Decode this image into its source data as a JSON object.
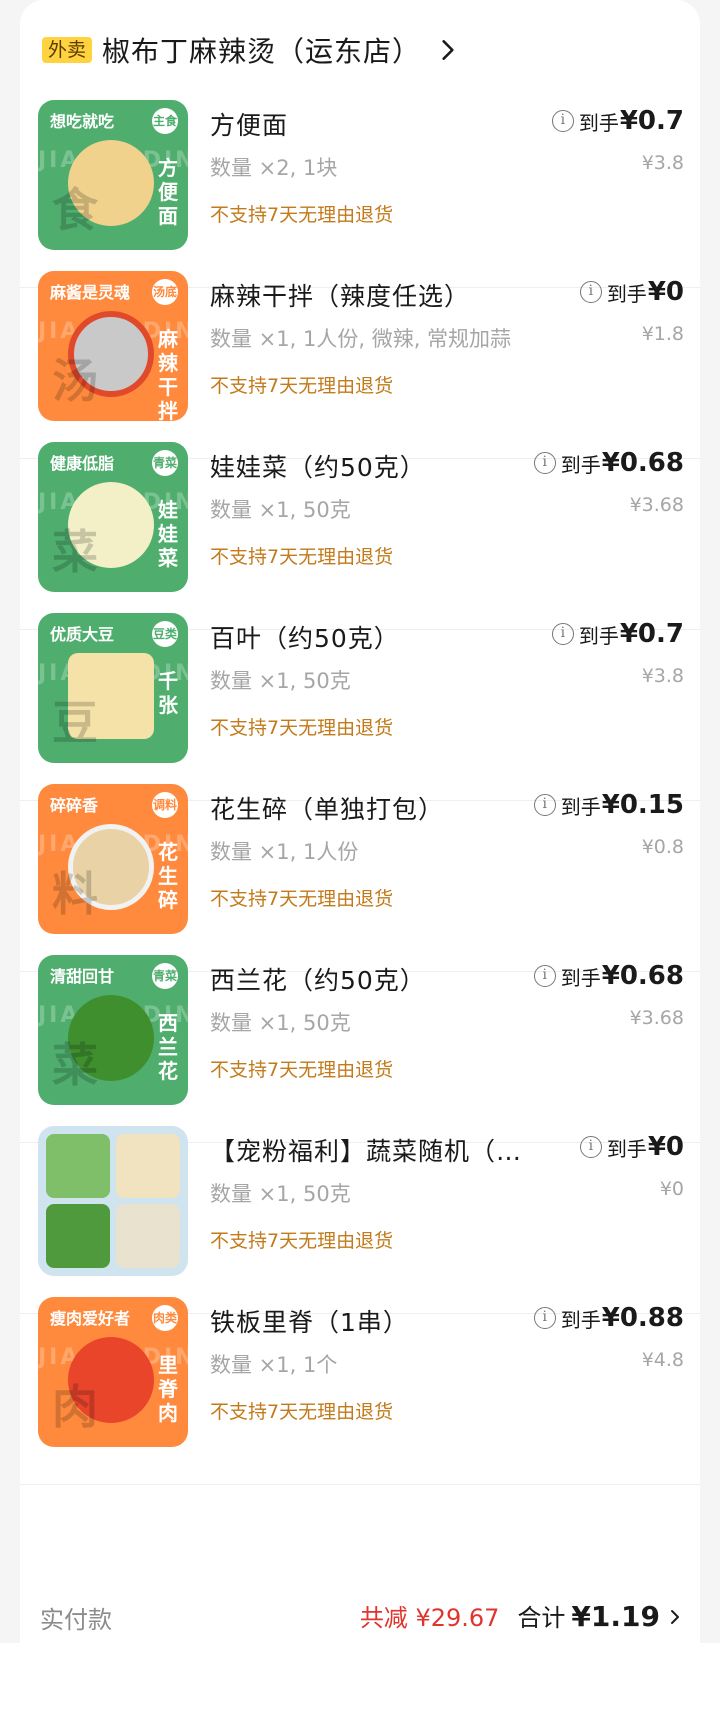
{
  "shop": {
    "tag": "外卖",
    "name": "椒布丁麻辣烫（运东店）"
  },
  "items": [
    {
      "name": "方便面",
      "spec": "数量 ×2, 1块",
      "policy": "不支持7天无理由退货",
      "price_label": "到手",
      "price": "¥0.7",
      "original_price": "¥3.8",
      "thumb": {
        "color": "#4fae6e",
        "label": "想吃就吃",
        "badge": "主食",
        "vertical": "方便面",
        "big": "食"
      }
    },
    {
      "name": "麻辣干拌（辣度任选）",
      "spec": "数量 ×1, 1人份, 微辣, 常规加蒜",
      "policy": "不支持7天无理由退货",
      "price_label": "到手",
      "price": "¥0",
      "original_price": "¥1.8",
      "thumb": {
        "color": "#ff8a3d",
        "label": "麻酱是灵魂",
        "badge": "汤底",
        "vertical": "麻辣干拌",
        "big": "汤"
      }
    },
    {
      "name": "娃娃菜（约50克）",
      "spec": "数量 ×1, 50克",
      "policy": "不支持7天无理由退货",
      "price_label": "到手",
      "price": "¥0.68",
      "original_price": "¥3.68",
      "thumb": {
        "color": "#4fae6e",
        "label": "健康低脂",
        "badge": "青菜",
        "vertical": "娃娃菜",
        "big": "菜"
      }
    },
    {
      "name": "百叶（约50克）",
      "spec": "数量 ×1, 50克",
      "policy": "不支持7天无理由退货",
      "price_label": "到手",
      "price": "¥0.7",
      "original_price": "¥3.8",
      "thumb": {
        "color": "#4fae6e",
        "label": "优质大豆",
        "badge": "豆类",
        "vertical": "千张",
        "big": "豆"
      }
    },
    {
      "name": "花生碎（单独打包）",
      "spec": "数量 ×1, 1人份",
      "policy": "不支持7天无理由退货",
      "price_label": "到手",
      "price": "¥0.15",
      "original_price": "¥0.8",
      "thumb": {
        "color": "#ff8a3d",
        "label": "碎碎香",
        "badge": "调料",
        "vertical": "花生碎",
        "big": "料"
      }
    },
    {
      "name": "西兰花（约50克）",
      "spec": "数量 ×1, 50克",
      "policy": "不支持7天无理由退货",
      "price_label": "到手",
      "price": "¥0.68",
      "original_price": "¥3.68",
      "thumb": {
        "color": "#4fae6e",
        "label": "清甜回甘",
        "badge": "青菜",
        "vertical": "西兰花",
        "big": "菜"
      }
    },
    {
      "name": "【宠粉福利】蔬菜随机（每…",
      "spec": "数量 ×1, 50克",
      "policy": "不支持7天无理由退货",
      "price_label": "到手",
      "price": "¥0",
      "original_price": "¥0",
      "thumb": {
        "color": "#cfe4ef",
        "label": "",
        "badge": "",
        "vertical": "",
        "big": ""
      }
    },
    {
      "name": "铁板里脊（1串）",
      "spec": "数量 ×1, 1个",
      "policy": "不支持7天无理由退货",
      "price_label": "到手",
      "price": "¥0.88",
      "original_price": "¥4.8",
      "thumb": {
        "color": "#ff8a3d",
        "label": "瘦肉爱好者",
        "badge": "肉类",
        "vertical": "里脊肉",
        "big": "肉"
      }
    }
  ],
  "footer": {
    "label": "实付款",
    "discount": "共减 ¥29.67",
    "total_label": "合计",
    "total": "¥1.19"
  }
}
